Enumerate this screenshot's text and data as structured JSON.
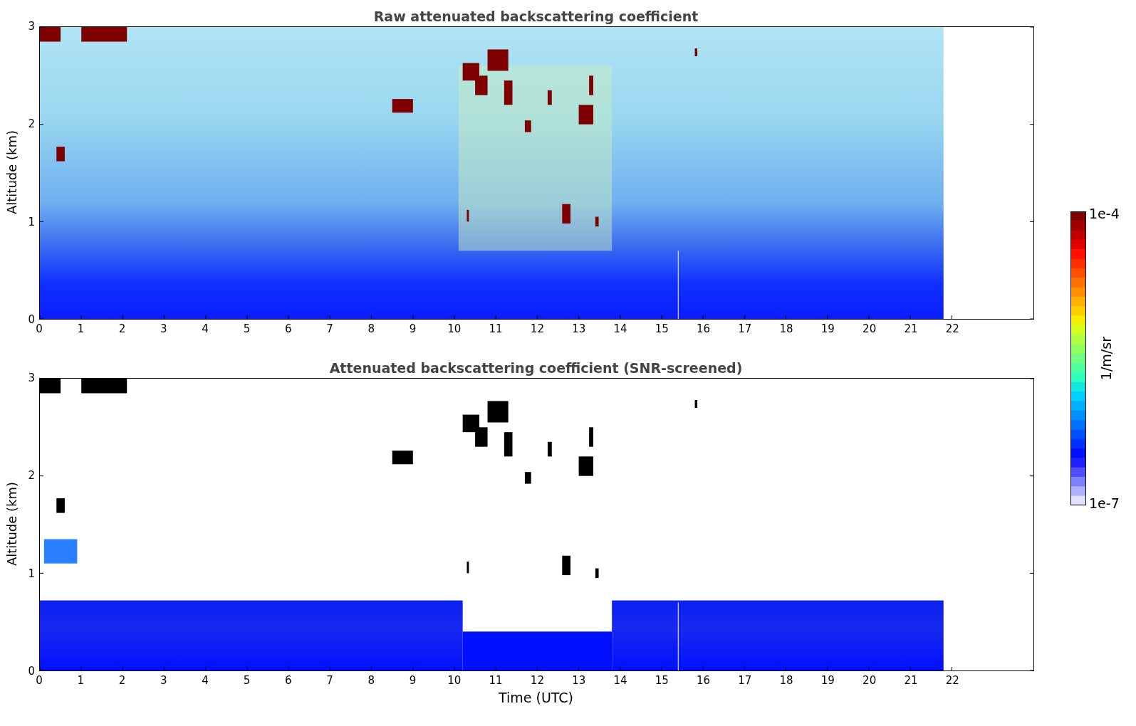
{
  "panels": [
    {
      "title": "Raw attenuated backscattering coefficient",
      "kind": "raw",
      "ylabel": "Altitude (km)",
      "yticks": [
        "3",
        "2",
        "1",
        "0"
      ],
      "xticks": [
        "0",
        "1",
        "2",
        "3",
        "4",
        "5",
        "6",
        "7",
        "8",
        "9",
        "10",
        "11",
        "12",
        "13",
        "14",
        "15",
        "16",
        "17",
        "18",
        "19",
        "20",
        "21",
        "22"
      ]
    },
    {
      "title": "Attenuated backscattering coefficient (SNR-screened)",
      "kind": "screened",
      "ylabel": "Altitude (km)",
      "yticks": [
        "3",
        "2",
        "1",
        "0"
      ],
      "xticks": [
        "0",
        "1",
        "2",
        "3",
        "4",
        "5",
        "6",
        "7",
        "8",
        "9",
        "10",
        "11",
        "12",
        "13",
        "14",
        "15",
        "16",
        "17",
        "18",
        "19",
        "20",
        "21",
        "22"
      ],
      "xlabel": "Time (UTC)"
    }
  ],
  "colorbar": {
    "label": "1/m/sr",
    "max_label": "1e-4",
    "min_label": "1e-7"
  }
}
